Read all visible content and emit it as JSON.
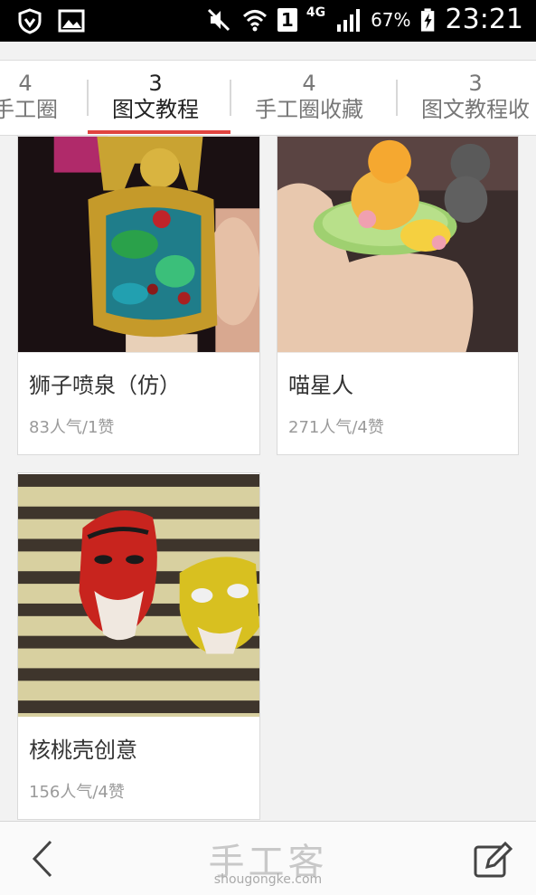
{
  "status_bar": {
    "battery": "67%",
    "network": "4G",
    "sim": "1",
    "time": "23:21"
  },
  "tabs": [
    {
      "count": "4",
      "label": "手工圈"
    },
    {
      "count": "3",
      "label": "图文教程"
    },
    {
      "count": "4",
      "label": "手工圈收藏"
    },
    {
      "count": "3",
      "label": "图文教程收"
    }
  ],
  "cards": [
    {
      "title": "狮子喷泉（仿）",
      "stats": "83人气/1赞"
    },
    {
      "title": "喵星人",
      "stats": "271人气/4赞"
    },
    {
      "title": "核桃壳创意",
      "stats": "156人气/4赞"
    }
  ],
  "footer": {
    "logo": "手工客",
    "site": "shougongke.com"
  },
  "colors": {
    "accent": "#e0443f",
    "status_bar": "#000000"
  }
}
